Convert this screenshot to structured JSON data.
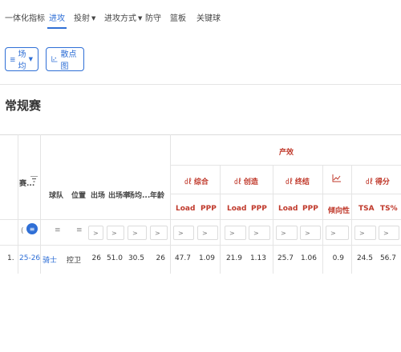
{
  "tabs": [
    {
      "label": "一体化指标"
    },
    {
      "label": "进攻"
    },
    {
      "label": "投射"
    },
    {
      "label": "进攻方式"
    },
    {
      "label": "防守"
    },
    {
      "label": "篮板"
    },
    {
      "label": "关键球"
    }
  ],
  "toolbar": {
    "per_game_label": "场均",
    "scatter_label": "散点图"
  },
  "section_title": "常规赛",
  "table": {
    "group_header": "产效",
    "season_header": "赛...",
    "team_header": "球队",
    "position_header": "位置",
    "games_header": "出场",
    "games_rate_header": "出场率",
    "minutes_header": "场均...",
    "age_header": "年龄",
    "sub_groups": [
      "综合",
      "创造",
      "终结",
      "",
      "得分"
    ],
    "sub_headers": [
      "Load",
      "PPP",
      "Load",
      "PPP",
      "Load",
      "PPP",
      "倾向性",
      "TSA",
      "TS%"
    ],
    "filter_prefix": "(",
    "filter_arrow": ">",
    "rows": [
      {
        "index": "1.",
        "season": "25-26",
        "team": "骑士",
        "position": "控卫",
        "games": "26",
        "games_rate": "51.0",
        "minutes": "30.5",
        "age": "26",
        "values": [
          "47.7",
          "1.09",
          "21.9",
          "1.13",
          "25.7",
          "1.06",
          "0.9",
          "24.5",
          "56.7"
        ]
      }
    ]
  },
  "colors": {
    "accent": "#2f6fd6",
    "group_header": "#c0392b"
  }
}
